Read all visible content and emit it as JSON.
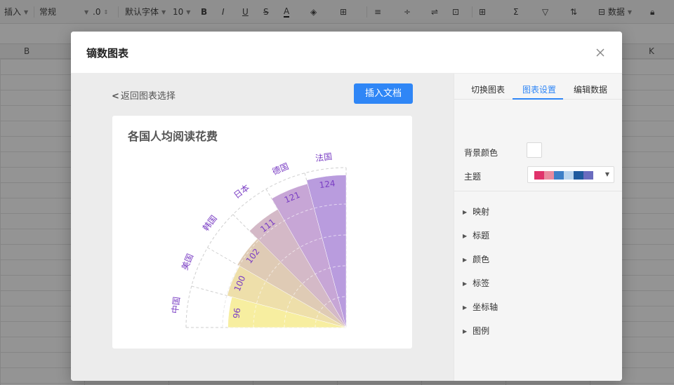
{
  "toolbar": {
    "insert": "插入",
    "format": "常规",
    "decimal": ".0",
    "font": "默认字体",
    "font_size": "10",
    "bold": "B",
    "italic": "I",
    "underline": "U",
    "strike": "S",
    "font_color": "A",
    "data": "数据"
  },
  "columns": {
    "b": "B",
    "k": "K"
  },
  "dialog": {
    "title": "镝数图表",
    "back_label": "返回图表选择",
    "insert_button": "插入文档"
  },
  "tabs": [
    {
      "label": "切换图表"
    },
    {
      "label": "图表设置"
    },
    {
      "label": "编辑数据"
    }
  ],
  "settings": {
    "bg_color_label": "背景颜色",
    "bg_color": "#ffffff",
    "theme_label": "主题",
    "theme_colors": [
      "#e0336b",
      "#e88a9e",
      "#3d7fc7",
      "#bcd6ee",
      "#1f5a9e",
      "#6a6cbf"
    ],
    "sections": [
      "映射",
      "标题",
      "颜色",
      "标签",
      "坐标轴",
      "图例"
    ]
  },
  "chart_data": {
    "type": "rose",
    "title": "各国人均阅读花费",
    "categories": [
      "中国",
      "美国",
      "韩国",
      "日本",
      "德国",
      "法国"
    ],
    "values": [
      96,
      100,
      102,
      111,
      121,
      124
    ],
    "colors": [
      "#f7eea0",
      "#eedfaa",
      "#dfcbb5",
      "#d4b9c7",
      "#c7a6d6",
      "#b99cde"
    ],
    "label_color": "#7b3fc4",
    "rmax": 130
  }
}
